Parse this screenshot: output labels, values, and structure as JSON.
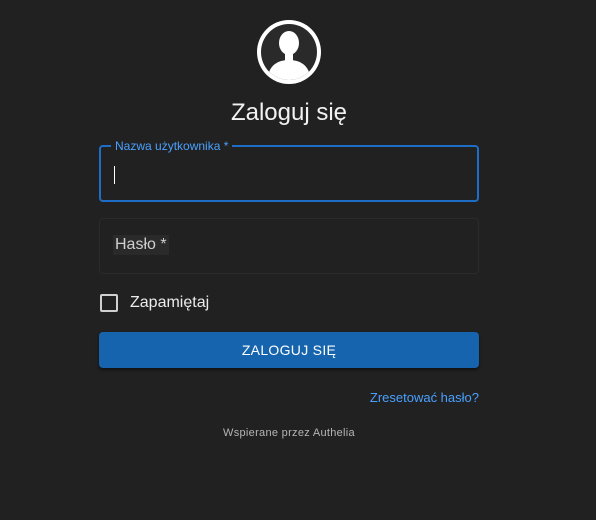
{
  "title": "Zaloguj się",
  "avatar": {
    "icon": "user-silhouette-icon"
  },
  "username": {
    "label": "Nazwa użytkownika *",
    "value": ""
  },
  "password": {
    "label": "Hasło *",
    "value": ""
  },
  "remember": {
    "label": "Zapamiętaj",
    "checked": false
  },
  "login_button": "ZALOGUJ SIĘ",
  "reset_link": "Zresetować hasło?",
  "powered_by": "Wspierane przez Authelia",
  "colors": {
    "background": "#212121",
    "accent": "#1e6ec8",
    "button": "#1664ad",
    "link": "#4aa0ff"
  }
}
